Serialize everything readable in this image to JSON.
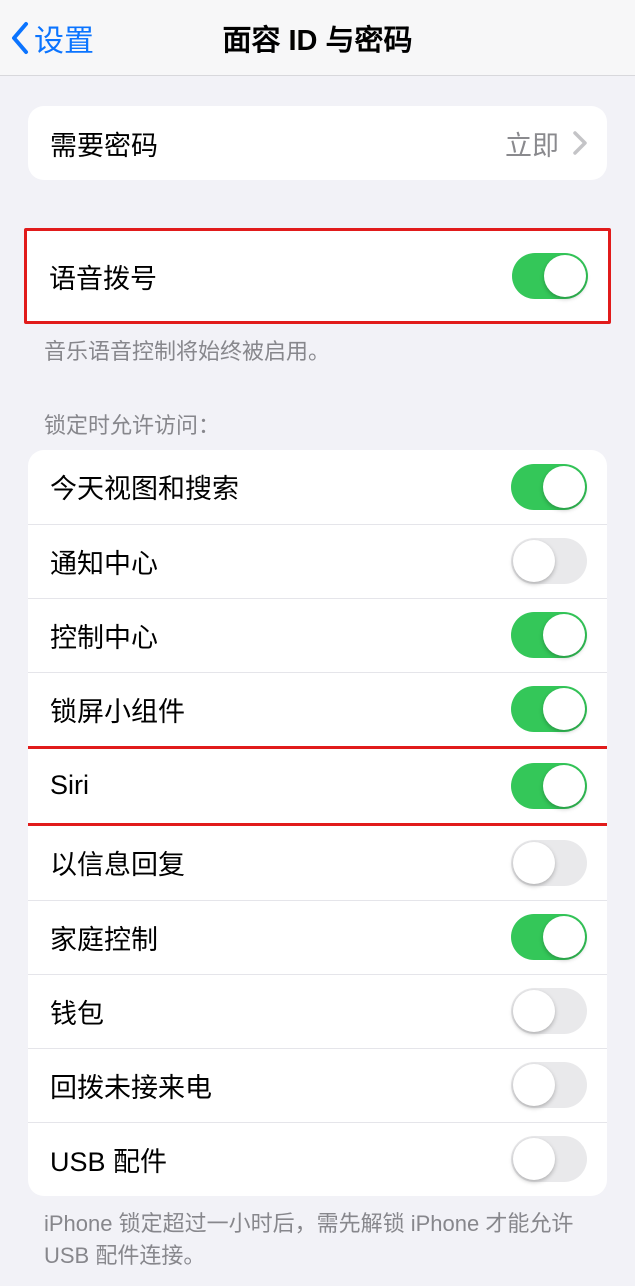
{
  "header": {
    "back_label": "设置",
    "title": "面容 ID 与密码"
  },
  "require_passcode": {
    "label": "需要密码",
    "value": "立即"
  },
  "voice_dial": {
    "label": "语音拨号",
    "footer": "音乐语音控制将始终被启用。",
    "on": true
  },
  "locked_section": {
    "header": "锁定时允许访问：",
    "items": [
      {
        "label": "今天视图和搜索",
        "on": true
      },
      {
        "label": "通知中心",
        "on": false
      },
      {
        "label": "控制中心",
        "on": true
      },
      {
        "label": "锁屏小组件",
        "on": true
      },
      {
        "label": "Siri",
        "on": true
      },
      {
        "label": "以信息回复",
        "on": false
      },
      {
        "label": "家庭控制",
        "on": true
      },
      {
        "label": "钱包",
        "on": false
      },
      {
        "label": "回拨未接来电",
        "on": false
      },
      {
        "label": "USB 配件",
        "on": false
      }
    ],
    "footer": "iPhone 锁定超过一小时后，需先解锁 iPhone 才能允许USB 配件连接。"
  },
  "annotations": {
    "highlight_voice_dial": true,
    "highlight_siri_row": true
  }
}
